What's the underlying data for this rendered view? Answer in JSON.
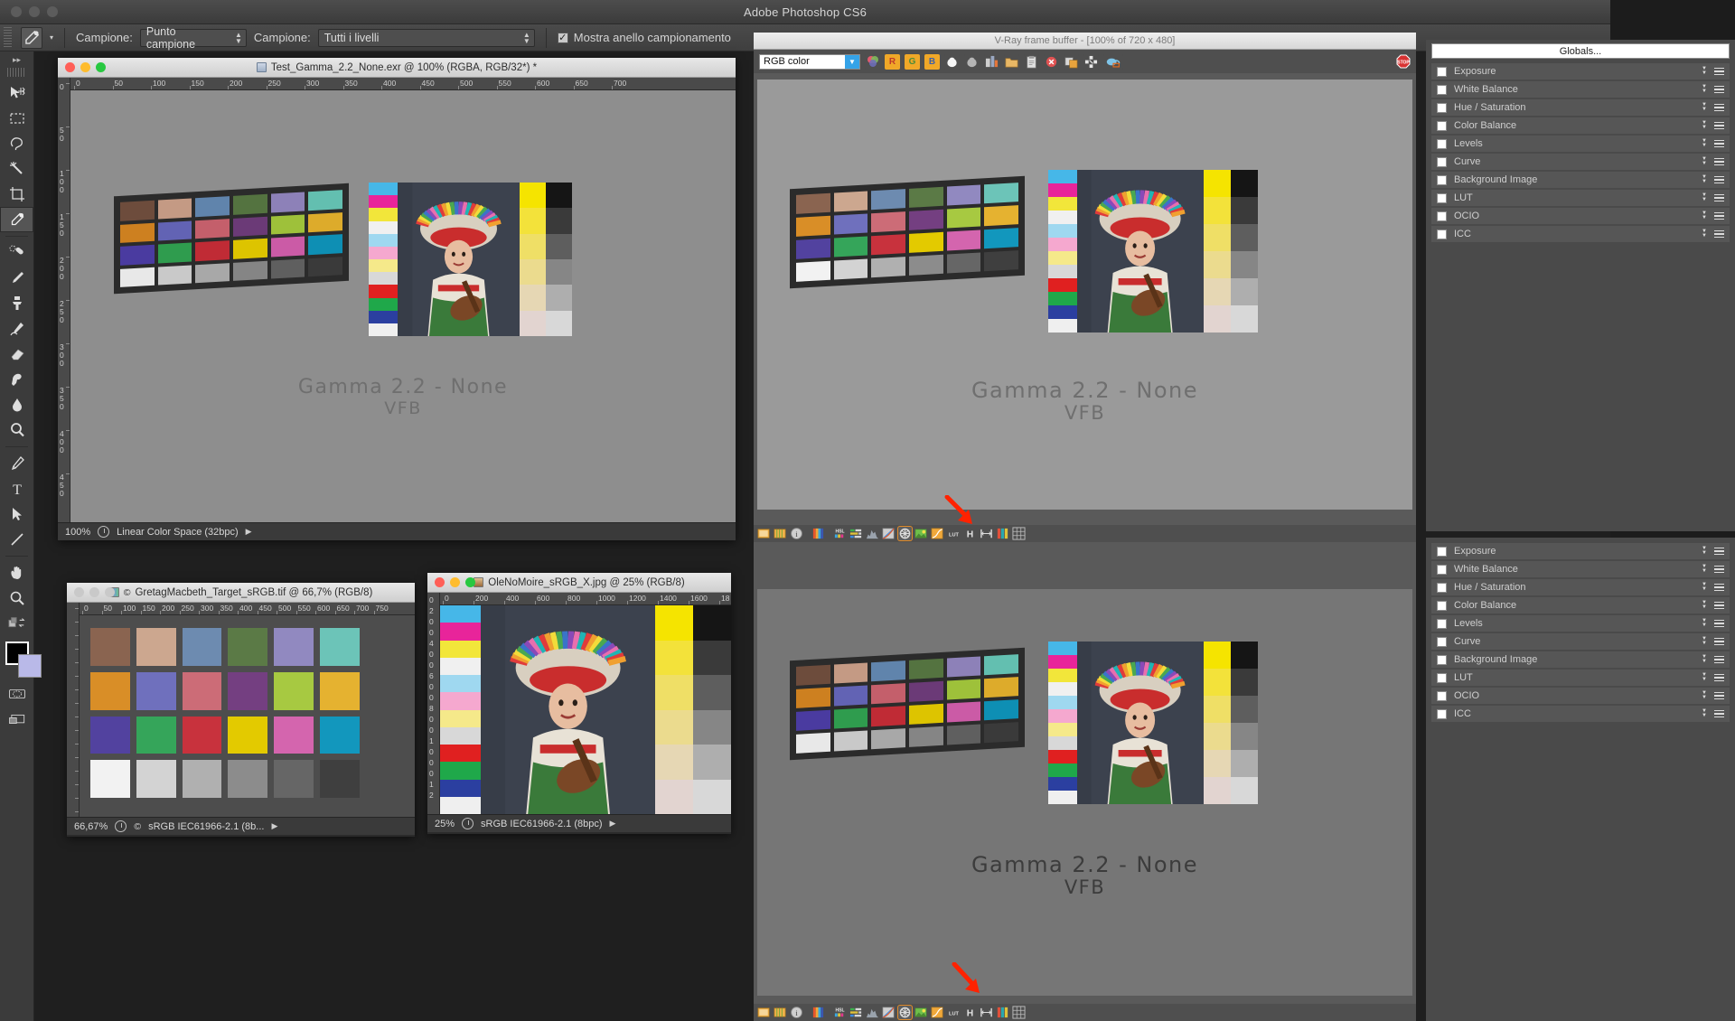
{
  "app": {
    "title": "Adobe Photoshop CS6",
    "window_controls": [
      "close",
      "minimize",
      "zoom"
    ]
  },
  "options_bar": {
    "tool_icon": "eyedropper-icon",
    "sample_label": "Campione:",
    "sample_size_value": "Punto campione",
    "sample_layers_label": "Campione:",
    "sample_layers_value": "Tutti i livelli",
    "show_ring_label": "Mostra anello campionamento",
    "show_ring_checked": true
  },
  "tools_panel": {
    "items": [
      "move-tool",
      "marquee-tool",
      "lasso-tool",
      "magic-wand-tool",
      "crop-tool",
      "eyedropper-tool",
      "healing-brush-tool",
      "brush-tool",
      "clone-stamp-tool",
      "history-brush-tool",
      "eraser-tool",
      "gradient-tool",
      "blur-tool",
      "dodge-tool",
      "pen-tool",
      "type-tool",
      "path-selection-tool",
      "line-tool",
      "hand-tool",
      "zoom-tool"
    ],
    "selected": "eyedropper-tool",
    "foreground_color": "#000000",
    "background_color": "#b9b9e8"
  },
  "doc_main": {
    "title": "Test_Gamma_2.2_None.exr @ 100% (RGBA, RGB/32*) *",
    "ruler_h": [
      "0",
      "50",
      "100",
      "150",
      "200",
      "250",
      "300",
      "350",
      "400",
      "450",
      "500",
      "550",
      "600",
      "650",
      "700"
    ],
    "ruler_v": [
      "0",
      "50",
      "100",
      "150",
      "200",
      "250",
      "300",
      "350",
      "400",
      "450"
    ],
    "zoom": "100%",
    "status": "Linear Color Space (32bpc)",
    "caption_line1": "Gamma 2.2 - None",
    "caption_line2": "VFB"
  },
  "doc_target": {
    "title": "GretagMacbeth_Target_sRGB.tif @ 66,7% (RGB/8)",
    "ruler_h": [
      "0",
      "50",
      "100",
      "150",
      "200",
      "250",
      "300",
      "350",
      "400",
      "450",
      "500",
      "550",
      "600",
      "650",
      "700",
      "750"
    ],
    "zoom": "66,67%",
    "status": "sRGB IEC61966-2.1 (8b..."
  },
  "doc_moire": {
    "title": "OleNoMoire_sRGB_X.jpg @ 25% (RGB/8)",
    "ruler_h": [
      "0",
      "200",
      "400",
      "600",
      "800",
      "1000",
      "1200",
      "1400",
      "1600",
      "18"
    ],
    "ruler_v": [
      "0",
      "2",
      "0",
      "0",
      "4",
      "0",
      "0",
      "6",
      "0",
      "0",
      "8",
      "0",
      "0",
      "1",
      "0",
      "0",
      "0",
      "1",
      "2"
    ],
    "zoom": "25%",
    "status": "sRGB IEC61966-2.1 (8bpc)"
  },
  "vfb_top": {
    "title": "V-Ray frame buffer - [100% of 720 x 480]",
    "channel_value": "RGB color",
    "caption_line1": "Gamma 2.2 - None",
    "caption_line2": "VFB",
    "toolbar_icons": [
      "color-channels-icon",
      "red-channel-icon",
      "green-channel-icon",
      "blue-channel-icon",
      "alpha-white-icon",
      "alpha-grey-icon",
      "render-scene-icon",
      "load-image-icon",
      "save-image-icon",
      "clear-image-icon",
      "duplicate-vfb-icon",
      "region-render-icon",
      "track-mouse-icon",
      "stop-render-icon"
    ],
    "footer_icons": [
      "force-color-clamp-icon",
      "pixel-aspect-icon",
      "info-icon",
      "color-corrections-icon",
      "hsl-icon",
      "color-balance-icon",
      "histogram-icon",
      "curve-icon",
      "exposure-icon",
      "background-image-icon",
      "lut-curve-icon",
      "lut-icon",
      "horizontal-icon",
      "stereo-icon",
      "levels-icon",
      "pixel-grid-icon"
    ],
    "footer_selected_index": 8
  },
  "vfb_bottom": {
    "caption_line1": "Gamma 2.2 - None",
    "caption_line2": "VFB",
    "footer_selected_index": 8
  },
  "right_panel": {
    "globals_label": "Globals...",
    "rows": [
      {
        "label": "Exposure",
        "checked": false
      },
      {
        "label": "White Balance",
        "checked": false
      },
      {
        "label": "Hue / Saturation",
        "checked": false
      },
      {
        "label": "Color Balance",
        "checked": false
      },
      {
        "label": "Levels",
        "checked": false
      },
      {
        "label": "Curve",
        "checked": false
      },
      {
        "label": "Background Image",
        "checked": false
      },
      {
        "label": "LUT",
        "checked": false
      },
      {
        "label": "OCIO",
        "checked": false
      },
      {
        "label": "ICC",
        "checked": false
      }
    ]
  },
  "right_panel_2": {
    "rows": [
      {
        "label": "Exposure",
        "checked": false
      },
      {
        "label": "White Balance",
        "checked": false
      },
      {
        "label": "Hue / Saturation",
        "checked": false
      },
      {
        "label": "Color Balance",
        "checked": false
      },
      {
        "label": "Levels",
        "checked": false
      },
      {
        "label": "Curve",
        "checked": false
      },
      {
        "label": "Background Image",
        "checked": false
      },
      {
        "label": "LUT",
        "checked": false
      },
      {
        "label": "OCIO",
        "checked": false
      },
      {
        "label": "ICC",
        "checked": false
      }
    ]
  },
  "colorchecker_dark": [
    "#6d4c3c",
    "#c49a84",
    "#6084ac",
    "#547340",
    "#8d81b8",
    "#63bfb0",
    "#cd8020",
    "#6263b4",
    "#c45f6b",
    "#6b3a77",
    "#9ec13a",
    "#ddab2b",
    "#4a3ba0",
    "#2f9c4e",
    "#c02b35",
    "#ddc400",
    "#cb5ba6",
    "#0e8fb4",
    "#e8e8e8",
    "#c9c9c9",
    "#a8a8a8",
    "#858585",
    "#5f5f5f",
    "#3a3a3a"
  ],
  "colorchecker_light": [
    "#8a6450",
    "#cca78f",
    "#6d8bb0",
    "#5b7a46",
    "#9189c0",
    "#6cc4b8",
    "#d98e27",
    "#6f70bd",
    "#cc6c77",
    "#743f81",
    "#a7c941",
    "#e5b230",
    "#52429f",
    "#35a55a",
    "#c8323d",
    "#e3ca00",
    "#d465ae",
    "#1297bd",
    "#f2f2f2",
    "#d3d3d3",
    "#b0b0b0",
    "#8c8c8c",
    "#666666",
    "#3f3f3f"
  ],
  "annotations": [
    {
      "name": "red-arrow-top",
      "color": "#ff2200"
    },
    {
      "name": "red-arrow-bottom",
      "color": "#ff2200"
    }
  ],
  "colors": {
    "accent_orange": "#e8a33d",
    "vfb_bg": "#9a9a9a",
    "panel_bg": "#4a4a4a",
    "arrow_red": "#ff2200"
  }
}
